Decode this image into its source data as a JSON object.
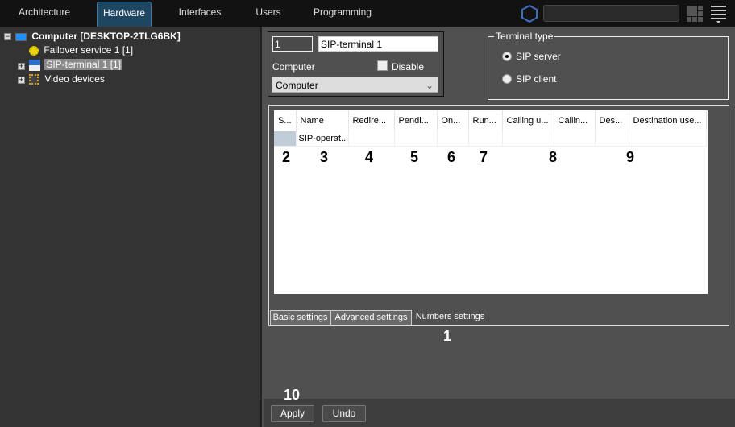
{
  "nav": {
    "tabs": [
      {
        "label": "Architecture"
      },
      {
        "label": "Hardware",
        "active": true
      },
      {
        "label": "Interfaces"
      },
      {
        "label": "Users"
      },
      {
        "label": "Programming"
      }
    ],
    "search_value": ""
  },
  "tree": {
    "items": [
      {
        "label": "Computer [DESKTOP-2TLG6BK]",
        "icon": "computer-icon"
      },
      {
        "label": "Failover service 1 [1]",
        "icon": "failover-icon"
      },
      {
        "label": "SIP-terminal 1 [1]",
        "icon": "sip-icon",
        "selected": true
      },
      {
        "label": "Video devices",
        "icon": "video-devices-icon"
      }
    ]
  },
  "form": {
    "id_value": "1",
    "name_value": "SIP-terminal 1",
    "computer_label": "Computer",
    "disable_label": "Disable",
    "disable_checked": false,
    "computer_select": "Computer"
  },
  "terminal_type": {
    "legend": "Terminal type",
    "options": [
      {
        "label": "SIP server",
        "selected": true
      },
      {
        "label": "SIP client",
        "selected": false
      }
    ]
  },
  "table": {
    "columns": [
      "S...",
      "Name",
      "Redire...",
      "Pendi...",
      "On...",
      "Run...",
      "Calling u...",
      "Callin...",
      "Des...",
      "Destination use..."
    ],
    "rows": [
      [
        "",
        "SIP-operat..",
        "",
        "",
        "",
        "",
        "",
        "",
        "",
        ""
      ]
    ]
  },
  "tabs": [
    {
      "label": "Basic settings"
    },
    {
      "label": "Advanced settings"
    },
    {
      "label": "Numbers settings",
      "active": true
    }
  ],
  "annotations": {
    "a1": "1",
    "a2": "2",
    "a3": "3",
    "a4": "4",
    "a5": "5",
    "a6": "6",
    "a7": "7",
    "a8": "8",
    "a9": "9",
    "a10": "10"
  },
  "buttons": {
    "apply": "Apply",
    "undo": "Undo"
  }
}
